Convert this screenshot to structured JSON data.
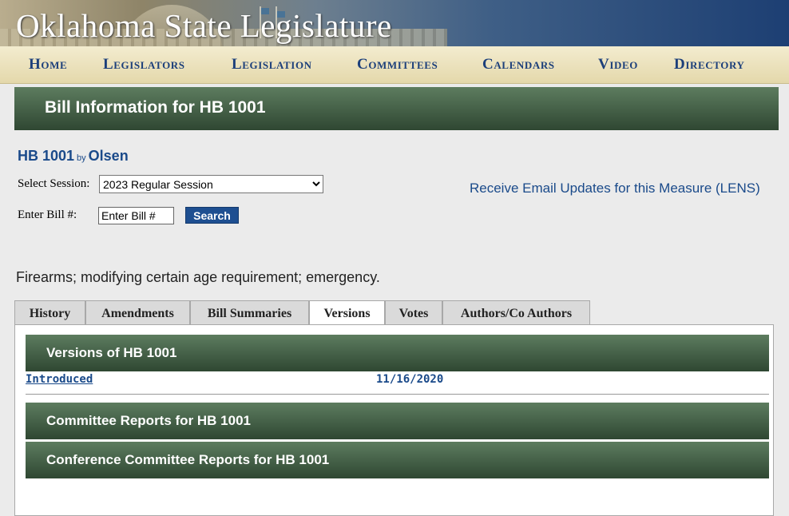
{
  "site": {
    "title": "Oklahoma State Legislature"
  },
  "nav": {
    "items": [
      "Home",
      "Legislators",
      "Legislation",
      "Committees",
      "Calendars",
      "Video",
      "Directory"
    ]
  },
  "page": {
    "header": "Bill Information for HB 1001"
  },
  "bill": {
    "number": "HB 1001",
    "by": "by",
    "author": "Olsen"
  },
  "form": {
    "session_label": "Select Session:",
    "session_value": "2023 Regular Session",
    "bill_label": "Enter Bill #:",
    "bill_placeholder": "Enter Bill #",
    "search_label": "Search"
  },
  "lens": {
    "label": "Receive Email Updates for this Measure (LENS)"
  },
  "description": "Firearms; modifying certain age requirement; emergency.",
  "tabs": [
    "History",
    "Amendments",
    "Bill Summaries",
    "Versions",
    "Votes",
    "Authors/Co Authors"
  ],
  "active_tab": "Versions",
  "versions": {
    "title": "Versions of HB 1001",
    "rows": [
      {
        "name": "Introduced",
        "date": "11/16/2020"
      }
    ]
  },
  "committee_reports": {
    "title": "Committee Reports for HB 1001"
  },
  "conference_reports": {
    "title": "Conference Committee Reports for HB 1001"
  },
  "colors": {
    "header_green": "#3f5a42",
    "nav_text": "#1c3f7a",
    "link_blue": "#1a4a8a",
    "search_button": "#1e4f91"
  }
}
